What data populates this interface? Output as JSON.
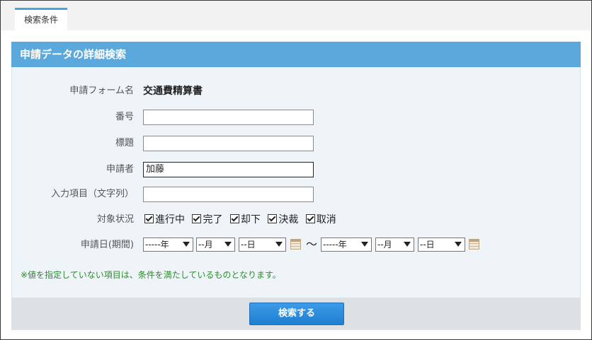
{
  "tab": {
    "label": "検索条件"
  },
  "section": {
    "title": "申請データの詳細検索"
  },
  "form": {
    "form_name_label": "申請フォーム名",
    "form_name_value": "交通費精算書",
    "number_label": "番号",
    "number_value": "",
    "subject_label": "標題",
    "subject_value": "",
    "applicant_label": "申請者",
    "applicant_value": "加藤",
    "input_item_label": "入力項目（文字列）",
    "input_item_value": "",
    "status_label": "対象状況",
    "statuses": [
      "進行中",
      "完了",
      "却下",
      "決裁",
      "取消"
    ],
    "date_label": "申請日(期間)",
    "from": {
      "year": "-----年",
      "month": "--月",
      "day": "--日"
    },
    "tilde": "〜",
    "to": {
      "year": "-----年",
      "month": "--月",
      "day": "--日"
    }
  },
  "note": "※値を指定していない項目は、条件を満たしているものとなります。",
  "footer": {
    "search_label": "検索する"
  }
}
